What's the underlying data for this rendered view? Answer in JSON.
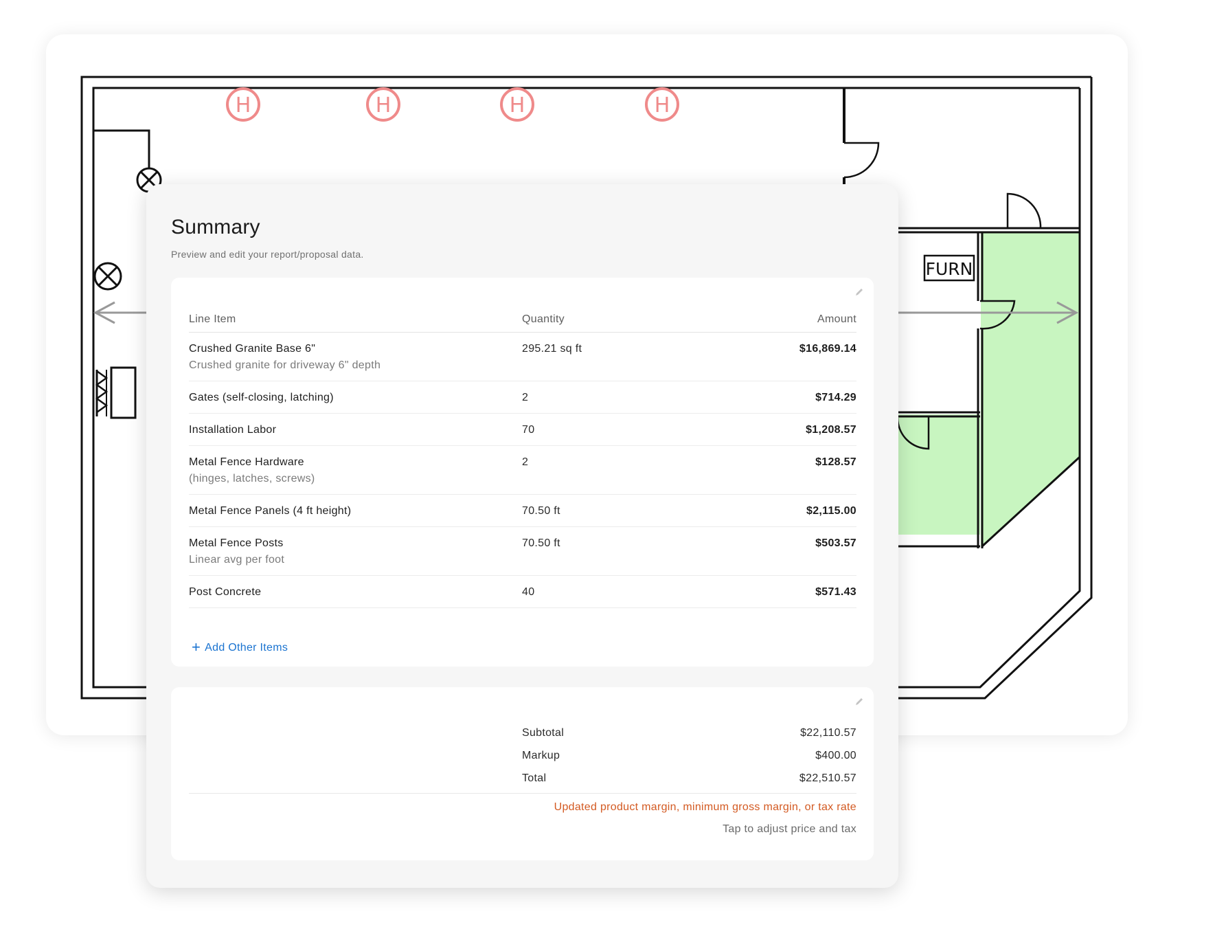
{
  "floor_plan": {
    "furnace_label": "FURN",
    "heater_symbol": "H"
  },
  "summary": {
    "title": "Summary",
    "subtitle": "Preview and edit your report/proposal data.",
    "edit_icon": "pencil-icon",
    "columns": {
      "item": "Line Item",
      "quantity": "Quantity",
      "amount": "Amount"
    },
    "rows": [
      {
        "name": "Crushed Granite Base 6\"",
        "description": "Crushed granite for driveway 6\" depth",
        "quantity": "295.21 sq ft",
        "amount": "$16,869.14"
      },
      {
        "name": "Gates (self-closing, latching)",
        "description": "",
        "quantity": "2",
        "amount": "$714.29"
      },
      {
        "name": "Installation Labor",
        "description": "",
        "quantity": "70",
        "amount": "$1,208.57"
      },
      {
        "name": "Metal Fence Hardware",
        "description": "(hinges, latches, screws)",
        "quantity": "2",
        "amount": "$128.57"
      },
      {
        "name": "Metal Fence Panels (4 ft height)",
        "description": "",
        "quantity": "70.50 ft",
        "amount": "$2,115.00"
      },
      {
        "name": "Metal Fence Posts",
        "description": "Linear avg per foot",
        "quantity": "70.50 ft",
        "amount": "$503.57"
      },
      {
        "name": "Post Concrete",
        "description": "",
        "quantity": "40",
        "amount": "$571.43"
      }
    ],
    "add_items_label": "Add Other Items",
    "totals": {
      "subtotal_label": "Subtotal",
      "subtotal_value": "$22,110.57",
      "markup_label": "Markup",
      "markup_value": "$400.00",
      "total_label": "Total",
      "total_value": "$22,510.57",
      "warning": "Updated product margin, minimum gross margin, or tax rate",
      "adjust_hint": "Tap to adjust price and tax"
    },
    "colors": {
      "accent_link": "#1a73d0",
      "warning": "#d35a22",
      "room_fill": "#c8f5c0",
      "heater_symbol": "#ef8a8a"
    }
  }
}
